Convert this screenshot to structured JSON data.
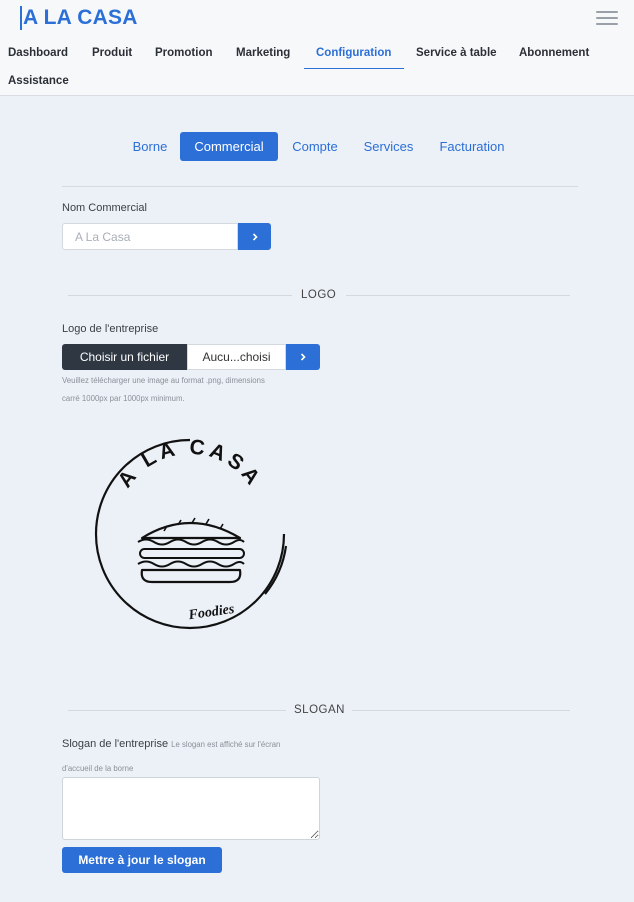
{
  "brand": "A LA CASA",
  "nav": {
    "items": [
      "Dashboard",
      "Produit",
      "Promotion",
      "Marketing",
      "Configuration",
      "Service à table",
      "Abonnement",
      "Assistance"
    ],
    "active": "Configuration"
  },
  "tabs": {
    "items": [
      "Borne",
      "Commercial",
      "Compte",
      "Services",
      "Facturation"
    ],
    "active": "Commercial"
  },
  "commercial": {
    "label": "Nom Commercial",
    "placeholder": "A La Casa",
    "submit_icon": "chevron-right-icon"
  },
  "logo": {
    "section_title": "LOGO",
    "label": "Logo de l'entreprise",
    "choose_button": "Choisir un fichier",
    "file_name": "Aucu...choisi",
    "submit_icon": "chevron-right-icon",
    "help_line1": "Veuillez télécharger une image au format .png, dimensions",
    "help_line2": "carré 1000px par 1000px minimum.",
    "image_text_top": "A LA CASA",
    "image_text_bottom": "Foodies"
  },
  "slogan": {
    "section_title": "SLOGAN",
    "label": "Slogan de l'entreprise",
    "hint_line1": "Le slogan est affiché sur l'écran",
    "hint_line2": "d'accueil de la borne",
    "value": "",
    "button": "Mettre à jour le slogan"
  },
  "colors": {
    "accent": "#2c6fd6",
    "dark_button": "#2f3743",
    "background": "#ecf1f7"
  }
}
